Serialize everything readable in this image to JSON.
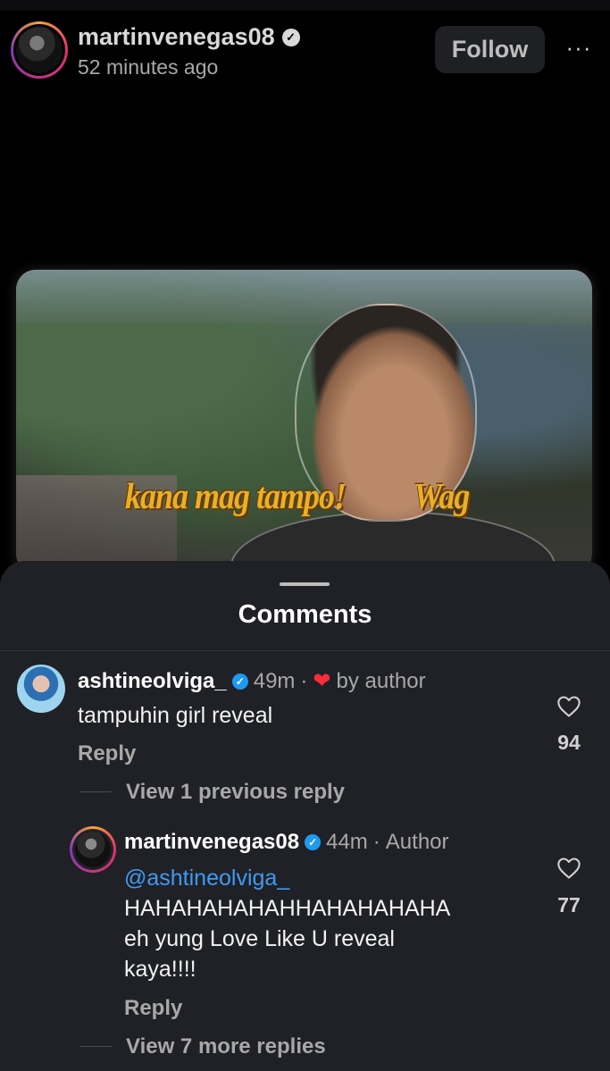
{
  "post": {
    "username": "martinvenegas08",
    "time_ago": "52 minutes ago",
    "follow_label": "Follow",
    "more_label": "···"
  },
  "video": {
    "caption_left": "kana mag tampo!",
    "caption_right": "Wag"
  },
  "comments_sheet": {
    "title": "Comments",
    "comments": [
      {
        "username": "ashtineolviga_",
        "time": "49m",
        "separator": "·",
        "liked_by_author_label": "by author",
        "text": "tampuhin girl reveal",
        "reply_label": "Reply",
        "likes": "94",
        "view_replies_label": "View 1 previous reply"
      },
      {
        "username": "martinvenegas08",
        "time": "44m",
        "separator": "·",
        "author_label": "Author",
        "mention": "@ashtineolviga_",
        "text_line2": "HAHAHAHAHAHHAHAHAHAHA",
        "text_line3": "eh yung Love Like U reveal",
        "text_line4": "kaya!!!!",
        "reply_label": "Reply",
        "likes": "77",
        "view_replies_label": "View 7 more replies"
      }
    ]
  },
  "colors": {
    "sheet_bg": "#202126",
    "verified_blue": "#1d9bf0",
    "mention_blue": "#3e9bf4",
    "heart_red": "#ff2d3c",
    "caption_gold": "#e8b025"
  },
  "icons": {
    "verified": "verified-badge-icon",
    "like": "heart-outline-icon",
    "author_like": "heart-filled-icon",
    "more": "more-options-icon"
  }
}
